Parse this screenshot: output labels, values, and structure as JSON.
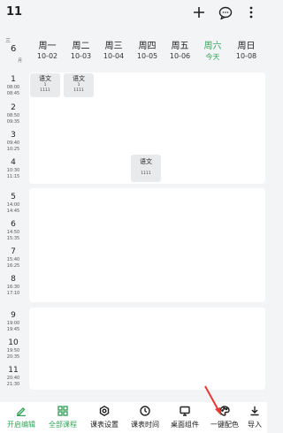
{
  "top": {
    "week": "11"
  },
  "month": {
    "top": "三",
    "num": "6",
    "unit": "月"
  },
  "days": [
    {
      "name": "周一",
      "date": "10-02"
    },
    {
      "name": "周二",
      "date": "10-03"
    },
    {
      "name": "周三",
      "date": "10-04"
    },
    {
      "name": "周四",
      "date": "10-05"
    },
    {
      "name": "周五",
      "date": "10-06"
    },
    {
      "name": "周六",
      "date": "今天"
    },
    {
      "name": "周日",
      "date": "10-08"
    }
  ],
  "periods": [
    {
      "n": "1",
      "start": "08:00",
      "end": "08:45"
    },
    {
      "n": "2",
      "start": "08:50",
      "end": "09:35"
    },
    {
      "n": "3",
      "start": "09:40",
      "end": "10:25"
    },
    {
      "n": "4",
      "start": "10:30",
      "end": "11:15"
    },
    {
      "n": "5",
      "start": "14:00",
      "end": "14:45"
    },
    {
      "n": "6",
      "start": "14:50",
      "end": "15:35"
    },
    {
      "n": "7",
      "start": "15:40",
      "end": "16:25"
    },
    {
      "n": "8",
      "start": "16:30",
      "end": "17:10"
    },
    {
      "n": "9",
      "start": "19:00",
      "end": "19:45"
    },
    {
      "n": "10",
      "start": "19:50",
      "end": "20:35"
    },
    {
      "n": "11",
      "start": "20:40",
      "end": "21:30"
    }
  ],
  "courses": [
    {
      "name": "语文",
      "line1": "1",
      "line2": "1111"
    },
    {
      "name": "语文",
      "line1": "1",
      "line2": "1111"
    },
    {
      "name": "语文",
      "line1": "",
      "line2": "1111"
    }
  ],
  "tabs": [
    {
      "label": "开启编辑",
      "icon": "edit-icon"
    },
    {
      "label": "全部课程",
      "icon": "grid-icon"
    },
    {
      "label": "课表设置",
      "icon": "gear-icon"
    },
    {
      "label": "课表时间",
      "icon": "clock-icon"
    },
    {
      "label": "桌面组件",
      "icon": "monitor-icon"
    },
    {
      "label": "一键配色",
      "icon": "palette-icon"
    },
    {
      "label": "导入",
      "icon": "import-icon"
    }
  ],
  "colors": {
    "accent": "#3aa35a",
    "background": "#f3f4f6",
    "card": "#ffffff",
    "course": "#e9eaec",
    "arrow": "#e53935"
  }
}
